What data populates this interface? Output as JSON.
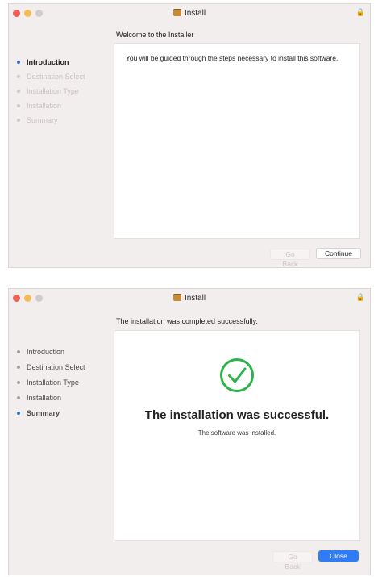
{
  "windows": [
    {
      "title": "Install",
      "header": "Welcome to the  Installer",
      "steps": [
        {
          "label": "Introduction",
          "active": true
        },
        {
          "label": "Destination Select",
          "active": false
        },
        {
          "label": "Installation Type",
          "active": false
        },
        {
          "label": "Installation",
          "active": false
        },
        {
          "label": "Summary",
          "active": false
        }
      ],
      "body_text": "You will be guided through the steps necessary to install this software.",
      "buttons": {
        "back": "Go Back",
        "continue": "Continue"
      }
    },
    {
      "title": "Install",
      "header": "The installation was completed successfully.",
      "steps": [
        {
          "label": "Introduction",
          "active": false
        },
        {
          "label": "Destination Select",
          "active": false
        },
        {
          "label": "Installation Type",
          "active": false
        },
        {
          "label": "Installation",
          "active": false
        },
        {
          "label": "Summary",
          "active": true
        }
      ],
      "success_headline": "The installation was successful.",
      "success_sub": "The software was installed.",
      "buttons": {
        "back": "Go Back",
        "close": "Close"
      }
    }
  ],
  "icons": {
    "app": "package-icon",
    "success": "checkmark-circle-icon",
    "lock": "lock-icon"
  },
  "colors": {
    "accent": "#2f7df6",
    "success": "#2cb34a",
    "window_bg": "#f3eeee"
  }
}
